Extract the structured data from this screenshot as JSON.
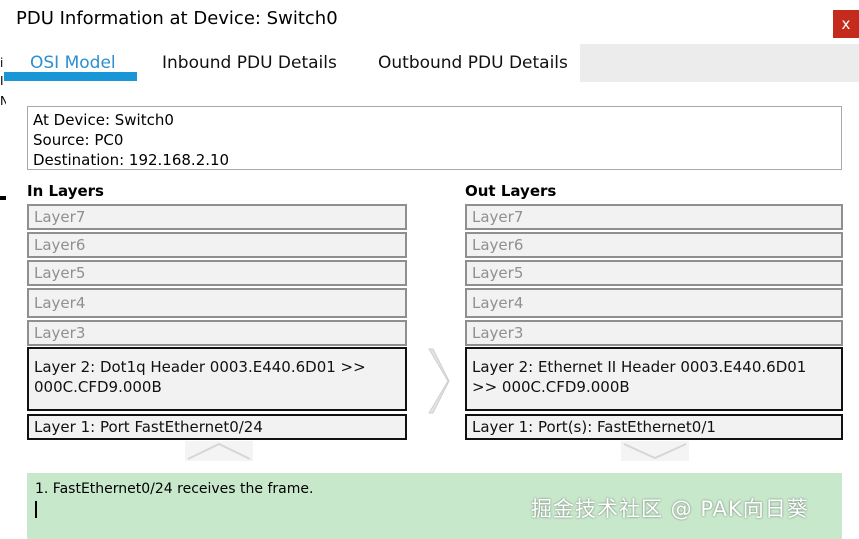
{
  "window": {
    "title": "PDU Information at Device: Switch0",
    "close_glyph": "x",
    "left_edge_fragments": [
      "i",
      "I",
      "N"
    ]
  },
  "tabs": [
    {
      "label": "OSI Model",
      "active": true
    },
    {
      "label": "Inbound PDU Details",
      "active": false
    },
    {
      "label": "Outbound PDU Details",
      "active": false
    }
  ],
  "info": {
    "device": "At Device: Switch0",
    "source": "Source: PC0",
    "destination": "Destination: 192.168.2.10"
  },
  "in_layers": {
    "heading": "In Layers",
    "layer7": "Layer7",
    "layer6": "Layer6",
    "layer5": "Layer5",
    "layer4": "Layer4",
    "layer3": "Layer3",
    "layer2": "Layer 2: Dot1q Header 0003.E440.6D01 >> 000C.CFD9.000B",
    "layer1": "Layer 1: Port FastEthernet0/24"
  },
  "out_layers": {
    "heading": "Out Layers",
    "layer7": "Layer7",
    "layer6": "Layer6",
    "layer5": "Layer5",
    "layer4": "Layer4",
    "layer3": "Layer3",
    "layer2": "Layer 2: Ethernet II Header 0003.E440.6D01 >> 000C.CFD9.000B",
    "layer1": "Layer 1: Port(s): FastEthernet0/1"
  },
  "status": {
    "message": "1. FastEthernet0/24 receives the frame."
  },
  "watermark": "掘金技术社区 @ PAK向日葵",
  "colors": {
    "accent": "#1996d5",
    "status_bg": "#c8e8cc",
    "close_bg": "#c42b1c"
  }
}
